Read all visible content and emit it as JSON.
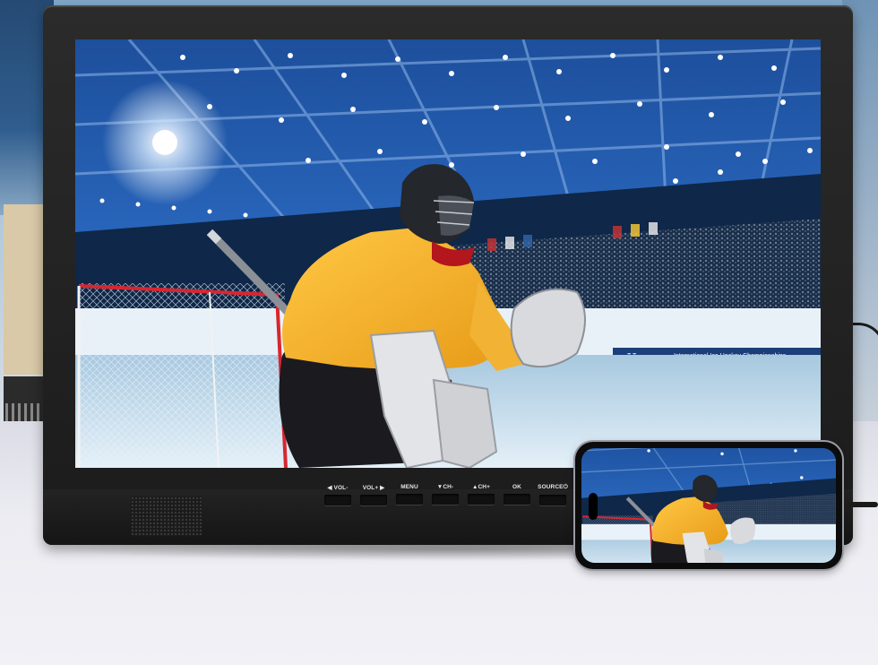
{
  "monitor": {
    "controls": [
      {
        "label": "◀ VOL-"
      },
      {
        "label": "VOL+ ▶"
      },
      {
        "label": "MENU"
      },
      {
        "label": "▼CH-"
      },
      {
        "label": "▲CH+"
      },
      {
        "label": "OK"
      },
      {
        "label": "SOURCE⏻"
      }
    ],
    "banner_text": "International Ice Hockey Championships",
    "banner_logo": "T  T"
  },
  "colors": {
    "bezel": "#1f1f1f",
    "jersey": "#f2b233",
    "ice": "#cfe6f3",
    "stadium": "#0d2a57"
  },
  "icons": {
    "speaker": "speaker-grille-icon",
    "cable": "usb-cable-icon"
  }
}
